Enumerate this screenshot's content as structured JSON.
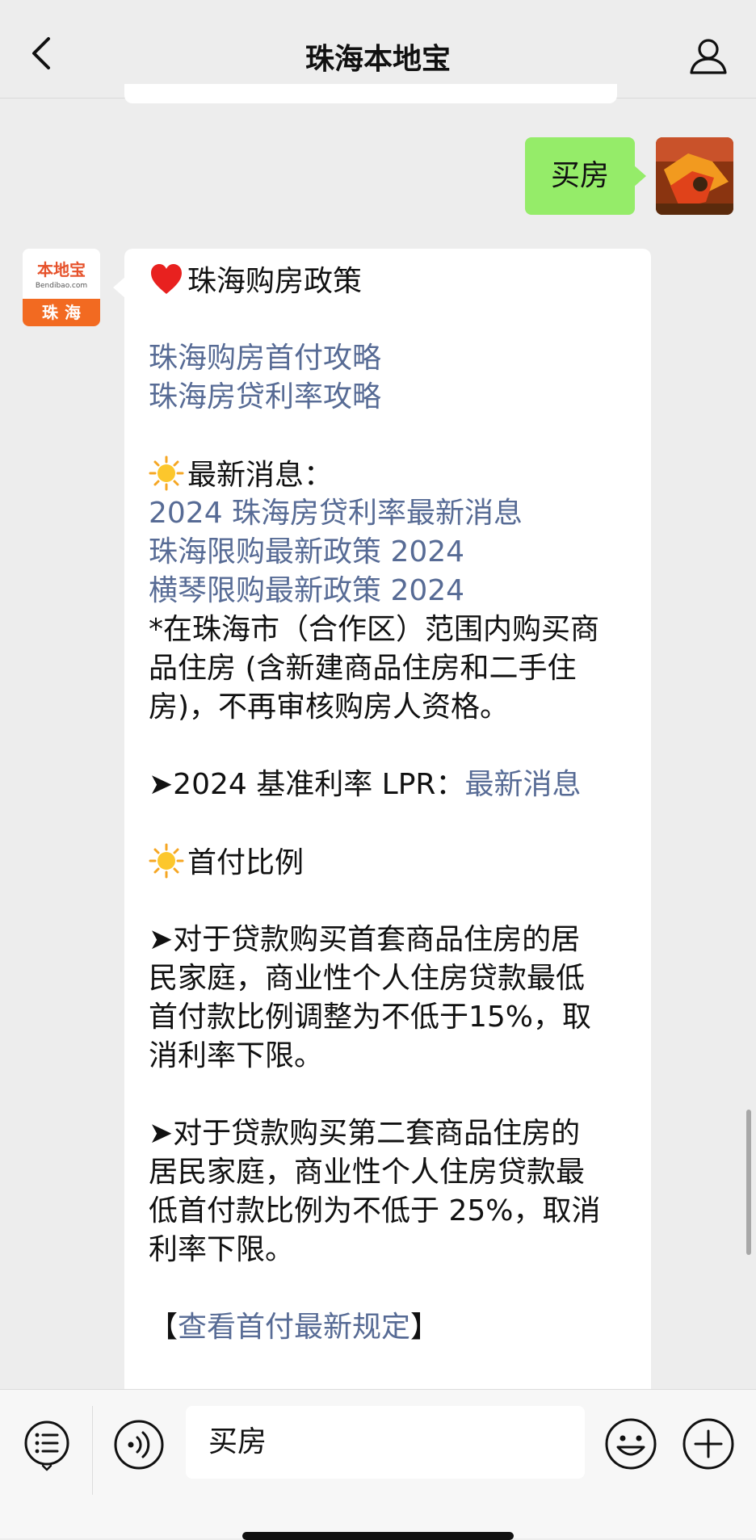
{
  "header": {
    "title": "珠海本地宝"
  },
  "outgoing": {
    "text": "买房"
  },
  "bot_avatar": {
    "main": "本地宝",
    "sub": "Bendibao.com",
    "city": "珠海"
  },
  "message": {
    "heading": "珠海购房政策",
    "links_top": [
      "珠海购房首付攻略",
      "珠海房贷利率攻略"
    ],
    "news_heading": "最新消息：",
    "news_links": [
      "2024 珠海房贷利率最新消息",
      "珠海限购最新政策 2024",
      "横琴限购最新政策 2024"
    ],
    "notice_lines": [
      "*在珠海市（合作区）范围内购买商",
      "品住房 (含新建商品住房和二手住",
      "房)，不再审核购房人资格。"
    ],
    "lpr_prefix": "➤2024 基准利率 LPR：",
    "lpr_link": "最新消息",
    "downpay_heading": "首付比例",
    "para1": [
      "➤对于贷款购买首套商品住房的居",
      "民家庭，商业性个人住房贷款最低",
      "首付款比例调整为不低于15%，取",
      "消利率下限。"
    ],
    "para2": [
      "➤对于贷款购买第二套商品住房的",
      "居民家庭，商业性个人住房贷款最",
      "低首付款比例为不低于 25%，取消",
      "利率下限。"
    ],
    "bracket_open": "【",
    "rule_link": "查看首付最新规定",
    "bracket_close": "】"
  },
  "input": {
    "value": "买房"
  },
  "colors": {
    "link": "#576b95",
    "out_bubble": "#95ec69",
    "brand_orange": "#f26a21"
  },
  "icons": [
    "back-arrow-icon",
    "user-profile-icon",
    "heart-icon",
    "sun-icon",
    "menu-list-icon",
    "voice-icon",
    "emoji-icon",
    "plus-icon"
  ]
}
